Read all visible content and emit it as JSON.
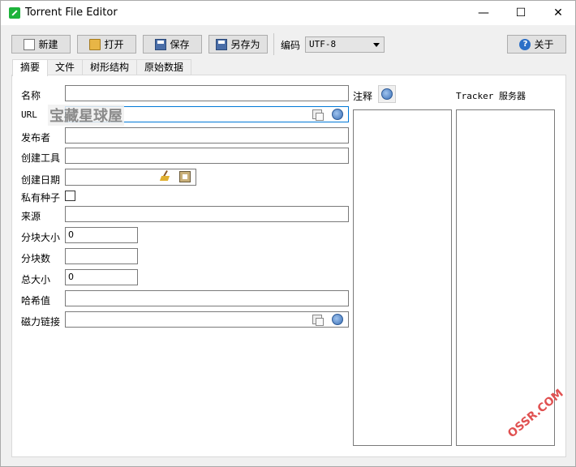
{
  "window": {
    "title": "Torrent File Editor",
    "min_glyph": "—",
    "max_glyph": "☐",
    "close_glyph": "✕"
  },
  "toolbar": {
    "new_label": "新建",
    "open_label": "打开",
    "save_label": "保存",
    "save_as_label": "另存为",
    "encoding_label": "编码",
    "encoding_value": "UTF-8",
    "about_label": "关于"
  },
  "tabs": [
    {
      "label": "摘要",
      "active": true
    },
    {
      "label": "文件",
      "active": false
    },
    {
      "label": "树形结构",
      "active": false
    },
    {
      "label": "原始数据",
      "active": false
    }
  ],
  "form": {
    "name_label": "名称",
    "url_label": "URL",
    "publisher_label": "发布者",
    "created_by_label": "创建工具",
    "created_date_label": "创建日期",
    "private_label": "私有种子",
    "source_label": "来源",
    "piece_size_label": "分块大小",
    "piece_size_value": "0",
    "piece_count_label": "分块数",
    "piece_count_value": "",
    "total_size_label": "总大小",
    "total_size_value": "0",
    "hash_label": "哈希值",
    "magnet_label": "磁力链接"
  },
  "notes": {
    "label": "注释"
  },
  "trackers": {
    "label": "Tracker 服务器"
  },
  "watermark": {
    "text": "宝藏星球屋",
    "corner": "OSSR.COM"
  },
  "icons": [
    "new-file-icon",
    "open-folder-icon",
    "save-icon",
    "save-as-icon",
    "help-icon",
    "copy-icon",
    "globe-icon",
    "broom-icon",
    "calendar-icon"
  ]
}
